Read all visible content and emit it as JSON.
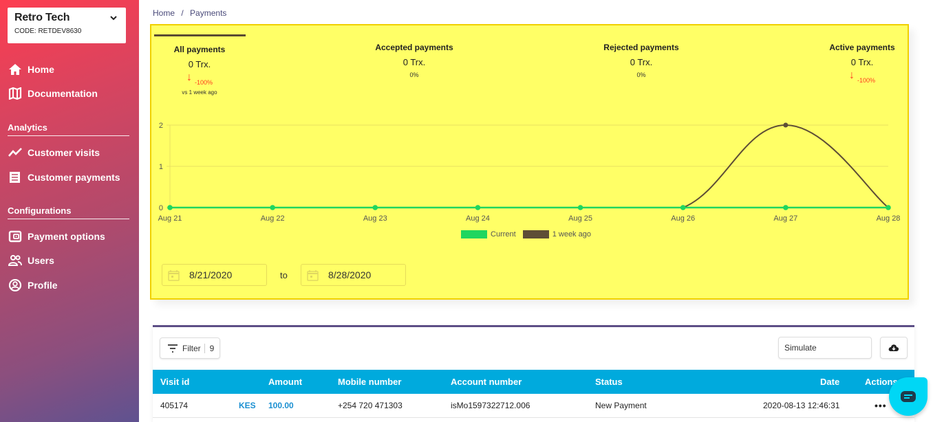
{
  "sidebar": {
    "org": {
      "name": "Retro Tech",
      "code": "CODE: RETDEV8630"
    },
    "items": [
      {
        "label": "Home",
        "icon": "home-icon"
      },
      {
        "label": "Documentation",
        "icon": "map-icon"
      }
    ],
    "sections": [
      {
        "title": "Analytics",
        "items": [
          {
            "label": "Customer visits",
            "icon": "trend-line-icon"
          },
          {
            "label": "Customer payments",
            "icon": "receipt-icon"
          }
        ]
      },
      {
        "title": "Configurations",
        "items": [
          {
            "label": "Payment options",
            "icon": "wallet-icon"
          },
          {
            "label": "Users",
            "icon": "users-icon"
          },
          {
            "label": "Profile",
            "icon": "profile-icon"
          }
        ]
      }
    ]
  },
  "breadcrumb": {
    "home": "Home",
    "separator": "/",
    "current": "Payments"
  },
  "stats": [
    {
      "title": "All payments",
      "value": "0 Trx.",
      "change": "-100%",
      "direction": "down",
      "comparison": "vs 1 week ago"
    },
    {
      "title": "Accepted payments",
      "value": "0 Trx.",
      "change": "0%"
    },
    {
      "title": "Rejected payments",
      "value": "0 Trx.",
      "change": "0%"
    },
    {
      "title": "Active payments",
      "value": "0 Trx.",
      "change": "-100%",
      "direction": "down"
    }
  ],
  "colors": {
    "current": "#1fd65f",
    "previous": "#5e4e36",
    "header": "#00aadd",
    "accent": "#5c4e86",
    "down": "#ff3b20"
  },
  "chart_data": {
    "type": "line",
    "categories": [
      "Aug 21",
      "Aug 22",
      "Aug 23",
      "Aug 24",
      "Aug 25",
      "Aug 26",
      "Aug 27",
      "Aug 28"
    ],
    "series": [
      {
        "name": "Current",
        "values": [
          0,
          0,
          0,
          0,
          0,
          0,
          0,
          0
        ]
      },
      {
        "name": "1 week ago",
        "values": [
          0,
          0,
          0,
          0,
          0,
          0,
          2,
          0
        ]
      }
    ],
    "yticks": [
      0,
      1,
      2
    ],
    "ylim": [
      0,
      2
    ],
    "grid": true,
    "legend": "bottom-center",
    "title": "",
    "xlabel": "",
    "ylabel": ""
  },
  "date_range": {
    "from": "8/21/2020",
    "to_label": "to",
    "to": "8/28/2020"
  },
  "table": {
    "filter_label": "Filter",
    "filter_count": "9",
    "simulate_value": "Simulate",
    "columns": [
      "Visit id",
      "Amount",
      "Mobile number",
      "Account number",
      "Status",
      "Date",
      "Actions"
    ],
    "rows": [
      {
        "visit_id": "405174",
        "currency": "KES",
        "amount": "100.00",
        "mobile": "+254 720 471303",
        "account": "isMo1597322712.006",
        "status": "New Payment",
        "date": "2020-08-13 12:46:31",
        "actions": "•••"
      }
    ]
  }
}
